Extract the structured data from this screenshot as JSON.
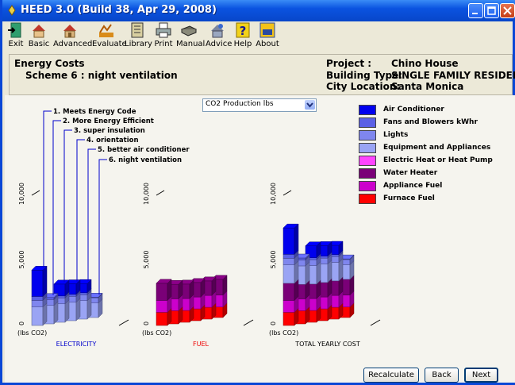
{
  "window": {
    "title": "HEED 3.0 (Build 38, Apr 29, 2008)"
  },
  "toolbar": [
    {
      "label": "Exit",
      "icon": "exit-icon"
    },
    {
      "label": "Basic",
      "icon": "basic-icon"
    },
    {
      "label": "Advanced",
      "icon": "advanced-icon"
    },
    {
      "label": "Evaluate",
      "icon": "evaluate-icon"
    },
    {
      "label": "Library",
      "icon": "library-icon"
    },
    {
      "label": "Print",
      "icon": "printer-icon"
    },
    {
      "label": "Manual",
      "icon": "manual-icon"
    },
    {
      "label": "Advice",
      "icon": "advice-icon"
    },
    {
      "label": "Help",
      "icon": "help-icon"
    },
    {
      "label": "About",
      "icon": "about-icon"
    }
  ],
  "header": {
    "title": "Energy Costs",
    "scheme": "Scheme 6 : night ventilation",
    "project_label": "Project :",
    "project_value": "Chino House",
    "building_label": "Building Type:",
    "building_value": "SINGLE FAMILY RESIDENCE",
    "city_label": "City Location:",
    "city_value": "Santa Monica"
  },
  "dropdown": {
    "selected": "CO2 Production lbs"
  },
  "schemes": [
    "1. Meets Energy Code",
    "2. More Energy Efficient",
    "3. super insulation",
    "4. orientation",
    "5. better air conditioner",
    "6. night ventilation"
  ],
  "buttons": {
    "recalculate": "Recalculate",
    "back": "Back",
    "next": "Next"
  },
  "chart_data": {
    "type": "bar",
    "stacked": true,
    "unit_label": "(lbs CO2)",
    "y_ticks": [
      "0",
      "5,000",
      "10,000"
    ],
    "ylim": [
      0,
      10000
    ],
    "panels": [
      {
        "title": "ELECTRICITY",
        "title_color": "#0000cc",
        "series": [
          {
            "name": "Equipment and Appliances",
            "color": "#9aa4f4",
            "values": [
              1400,
              1400,
              1400,
              1400,
              1400,
              1100
            ]
          },
          {
            "name": "Lights",
            "color": "#7f86ee",
            "values": [
              500,
              450,
              450,
              450,
              450,
              400
            ]
          },
          {
            "name": "Fans and Blowers kWhr",
            "color": "#5b61e6",
            "values": [
              300,
              150,
              150,
              150,
              150,
              50
            ]
          },
          {
            "name": "Air Conditioner",
            "color": "#0000ee",
            "values": [
              2000,
              0,
              900,
              800,
              700,
              0
            ]
          }
        ]
      },
      {
        "title": "FUEL",
        "title_color": "#ee0000",
        "series": [
          {
            "name": "Furnace Fuel",
            "color": "#ff0000",
            "values": [
              1000,
              1000,
              900,
              900,
              900,
              800
            ]
          },
          {
            "name": "Appliance Fuel",
            "color": "#cc00cc",
            "values": [
              900,
              900,
              900,
              900,
              900,
              900
            ]
          },
          {
            "name": "Water Heater",
            "color": "#7a0077",
            "values": [
              1300,
              1100,
              1100,
              1100,
              1100,
              1200
            ]
          }
        ]
      },
      {
        "title": "TOTAL YEARLY COST",
        "title_color": "#000000",
        "series": [
          {
            "name": "Furnace Fuel",
            "color": "#ff0000",
            "values": [
              1000,
              1000,
              900,
              900,
              900,
              800
            ]
          },
          {
            "name": "Appliance Fuel",
            "color": "#cc00cc",
            "values": [
              900,
              900,
              900,
              900,
              900,
              900
            ]
          },
          {
            "name": "Water Heater",
            "color": "#7a0077",
            "values": [
              1300,
              1100,
              1100,
              1100,
              1100,
              1200
            ]
          },
          {
            "name": "Equipment and Appliances",
            "color": "#9aa4f4",
            "values": [
              1400,
              1400,
              1400,
              1400,
              1400,
              1100
            ]
          },
          {
            "name": "Lights",
            "color": "#7f86ee",
            "values": [
              500,
              450,
              450,
              450,
              450,
              400
            ]
          },
          {
            "name": "Fans and Blowers kWhr",
            "color": "#5b61e6",
            "values": [
              300,
              150,
              150,
              150,
              150,
              50
            ]
          },
          {
            "name": "Air Conditioner",
            "color": "#0000ee",
            "values": [
              2000,
              0,
              900,
              800,
              700,
              0
            ]
          }
        ]
      }
    ],
    "legend": [
      {
        "name": "Air Conditioner",
        "color": "#0000ee"
      },
      {
        "name": "Fans and Blowers kWhr",
        "color": "#5b61e6"
      },
      {
        "name": "Lights",
        "color": "#7f86ee"
      },
      {
        "name": "Equipment and Appliances",
        "color": "#9aa4f4"
      },
      {
        "name": "Electric Heat or Heat Pump",
        "color": "#ff44ff"
      },
      {
        "name": "Water Heater",
        "color": "#7a0077"
      },
      {
        "name": "Appliance Fuel",
        "color": "#cc00cc"
      },
      {
        "name": "Furnace Fuel",
        "color": "#ff0000"
      }
    ]
  }
}
